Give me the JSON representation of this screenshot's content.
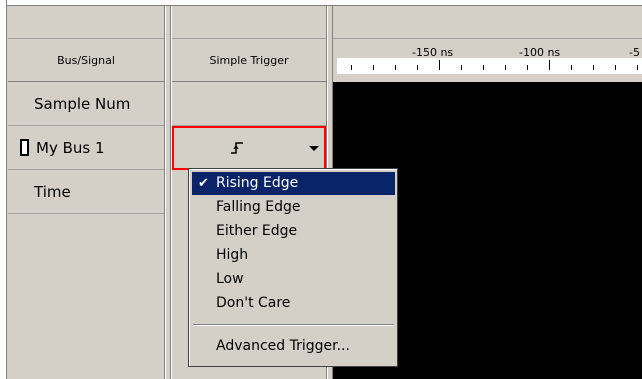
{
  "columns": {
    "bus_signal_header": "Bus/Signal",
    "trigger_header": "Simple Trigger"
  },
  "rows": {
    "sample_num": "Sample Num",
    "bus": "My Bus 1",
    "time": "Time"
  },
  "ruler": {
    "labels": [
      "-150 ns",
      "-100 ns",
      "-5"
    ]
  },
  "trigger": {
    "current_icon": "rising-edge-icon",
    "glyph": "̸̲‾"
  },
  "menu": {
    "items": [
      {
        "label": "Rising Edge",
        "selected": true
      },
      {
        "label": "Falling Edge",
        "selected": false
      },
      {
        "label": "Either Edge",
        "selected": false
      },
      {
        "label": "High",
        "selected": false
      },
      {
        "label": "Low",
        "selected": false
      },
      {
        "label": "Don't Care",
        "selected": false
      },
      {
        "label": "Advanced Trigger...",
        "selected": false
      }
    ]
  },
  "colors": {
    "highlight": "#0a246a",
    "trigger_border": "#ff0000",
    "wave_background": "#000000"
  }
}
